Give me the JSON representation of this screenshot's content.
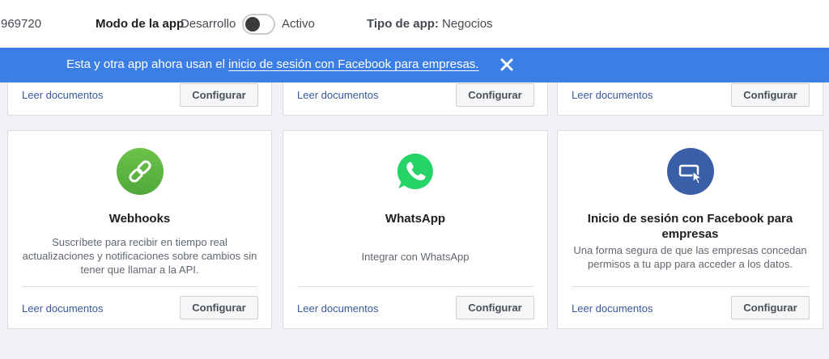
{
  "header": {
    "app_id": "969720",
    "mode_label": "Modo de la app",
    "mode_dev": "Desarrollo",
    "mode_active": "Activo",
    "app_type_label": "Tipo de app:",
    "app_type_value": "Negocios",
    "toggle_state": "off"
  },
  "banner": {
    "text": "Esta y otra app ahora usan el",
    "link": "inicio de sesión con Facebook para empresas.",
    "close_icon": "close-icon",
    "color": "#3b7ee5"
  },
  "top_cards": [
    {
      "link": "Leer documentos",
      "button": "Configurar"
    },
    {
      "link": "Leer documentos",
      "button": "Configurar"
    },
    {
      "link": "Leer documentos",
      "button": "Configurar"
    }
  ],
  "products": [
    {
      "icon": "link-icon",
      "icon_color": "#5cb85c",
      "title": "Webhooks",
      "description": "Suscríbete para recibir en tiempo real actualizaciones y notificaciones sobre cambios sin tener que llamar a la API.",
      "link": "Leer documentos",
      "button": "Configurar"
    },
    {
      "icon": "whatsapp-icon",
      "icon_color": "#25d366",
      "title": "WhatsApp",
      "description": "Integrar con WhatsApp",
      "link": "Leer documentos",
      "button": "Configurar"
    },
    {
      "icon": "login-card-icon",
      "icon_color": "#3b5ea8",
      "title": "Inicio de sesión con Facebook para empresas",
      "description": "Una forma segura de que las empresas concedan permisos a tu app para acceder a los datos.",
      "link": "Leer documentos",
      "button": "Configurar"
    }
  ]
}
